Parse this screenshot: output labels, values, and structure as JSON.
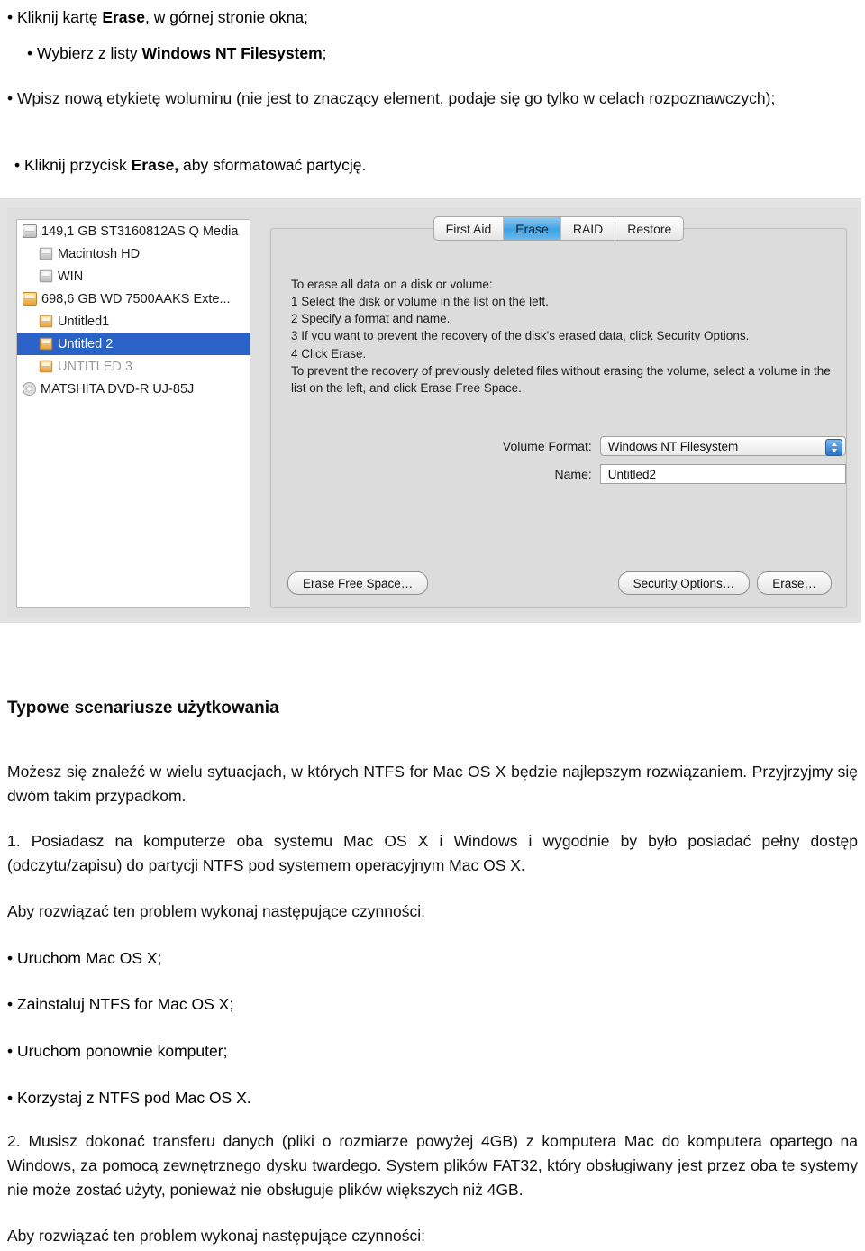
{
  "document": {
    "top_bullets": [
      {
        "id": "b1",
        "prefix": "• Kliknij kartę ",
        "bold": "Erase",
        "suffix": ", w górnej stronie okna;"
      },
      {
        "id": "b2",
        "prefix": "• Wybierz z listy ",
        "bold": "Windows NT Filesystem",
        "suffix": ";"
      },
      {
        "id": "b3",
        "prefix": "• Wpisz nową etykietę woluminu (nie jest to znaczący element, podaje się go tylko w celach rozpoznawczych);",
        "bold": "",
        "suffix": ""
      },
      {
        "id": "b4",
        "prefix": "• Kliknij przycisk ",
        "bold": "Erase,",
        "suffix": " aby sformatować partycję."
      }
    ],
    "section_heading": "Typowe scenariusze użytkowania",
    "intro_paragraph": "Możesz się znaleźć w wielu sytuacjach, w których NTFS for Mac OS X będzie najlepszym rozwiązaniem. Przyjrzyjmy się dwóm takim przypadkom.",
    "scenario_1": "1. Posiadasz na komputerze oba systemu Mac OS X i Windows i wygodnie by było posiadać pełny dostęp (odczytu/zapisu) do partycji NTFS pod systemem operacyjnym Mac OS X.",
    "solution_lead_1": "Aby rozwiązać ten problem wykonaj następujące czynności:",
    "steps": [
      "• Uruchom Mac OS X;",
      "• Zainstaluj NTFS for Mac OS X;",
      "• Uruchom ponownie komputer;",
      "• Korzystaj z NTFS pod Mac OS X."
    ],
    "scenario_2": "2. Musisz dokonać transferu danych (pliki o rozmiarze powyżej 4GB) z komputera Mac do komputera opartego na Windows, za pomocą zewnętrznego dysku twardego. System plików FAT32, który obsługiwany jest przez oba te systemy nie może zostać użyty, ponieważ nie obsługuje plików większych niż 4GB.",
    "solution_lead_2": "Aby rozwiązać ten problem wykonaj następujące czynności:"
  },
  "screenshot": {
    "app": "Disk Utility",
    "sidebar": {
      "items": [
        {
          "label": "149,1 GB ST3160812AS Q Media",
          "icon": "hard-drive-icon",
          "indent": false,
          "selected": false,
          "dim": false,
          "icon_style": "drive-gray"
        },
        {
          "label": "Macintosh HD",
          "icon": "volume-icon",
          "indent": true,
          "selected": false,
          "dim": false,
          "icon_style": "drive-gray"
        },
        {
          "label": "WIN",
          "icon": "volume-icon",
          "indent": true,
          "selected": false,
          "dim": false,
          "icon_style": "drive-gray"
        },
        {
          "label": "698,6 GB WD 7500AAKS Exte...",
          "icon": "external-drive-icon",
          "indent": false,
          "selected": false,
          "dim": false,
          "icon_style": "drive-orange"
        },
        {
          "label": "Untitled1",
          "icon": "volume-icon",
          "indent": true,
          "selected": false,
          "dim": false,
          "icon_style": "drive-orange"
        },
        {
          "label": "Untitled 2",
          "icon": "volume-icon",
          "indent": true,
          "selected": true,
          "dim": false,
          "icon_style": "drive-orange"
        },
        {
          "label": "UNTITLED 3",
          "icon": "volume-icon",
          "indent": true,
          "selected": false,
          "dim": true,
          "icon_style": "drive-orange"
        },
        {
          "label": "MATSHITA DVD-R UJ-85J",
          "icon": "optical-disc-icon",
          "indent": false,
          "selected": false,
          "dim": false,
          "icon_style": "disc"
        }
      ]
    },
    "tabs": [
      {
        "label": "First Aid",
        "active": false
      },
      {
        "label": "Erase",
        "active": true
      },
      {
        "label": "RAID",
        "active": false
      },
      {
        "label": "Restore",
        "active": false
      }
    ],
    "instructions": {
      "heading": "To erase all data on a disk or volume:",
      "steps": [
        "1 Select the disk or volume in the list on the left.",
        "2 Specify a format and name.",
        "3 If you want to prevent the recovery of the disk's erased data, click Security Options.",
        "4 Click Erase."
      ],
      "note": "To prevent the recovery of previously deleted files without erasing the volume, select a volume in the list on the left, and click Erase Free Space."
    },
    "form": {
      "volume_format_label": "Volume Format:",
      "volume_format_value": "Windows NT Filesystem",
      "name_label": "Name:",
      "name_value": "Untitled2"
    },
    "buttons": {
      "erase_free_space": "Erase Free Space…",
      "security_options": "Security Options…",
      "erase": "Erase…"
    },
    "colors": {
      "selection_blue": "#2a62c8",
      "active_tab_blue": "#3ea2e3",
      "panel_gray": "#dcdcdc",
      "window_gray": "#e3e3e3"
    }
  }
}
